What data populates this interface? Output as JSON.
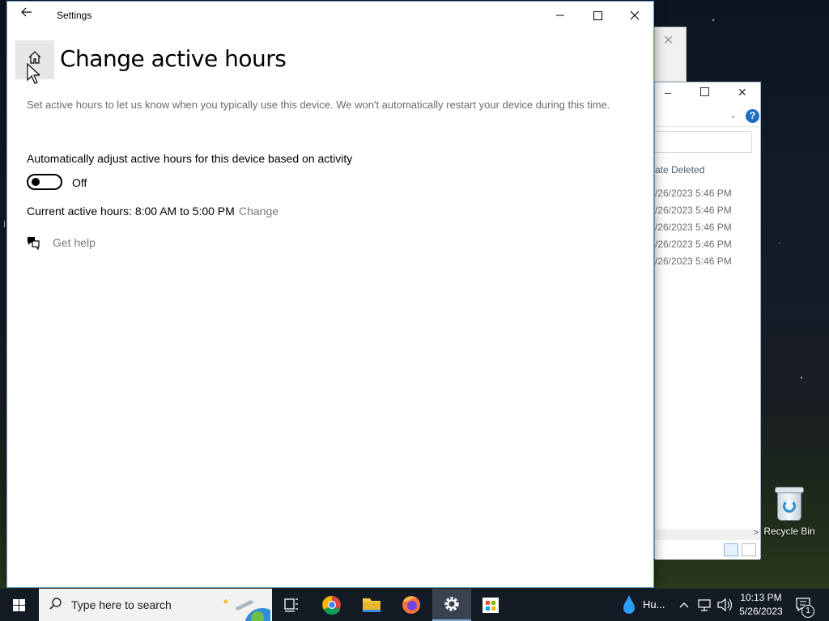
{
  "settings_window": {
    "title": "Settings",
    "page_title": "Change active hours",
    "description": "Set active hours to let us know when you typically use this device. We won't automatically restart your device during this time.",
    "auto_adjust_label": "Automatically adjust active hours for this device based on activity",
    "toggle_state": "Off",
    "current_hours_text": "Current active hours: 8:00 AM to 5:00 PM",
    "change_link": "Change",
    "get_help_link": "Get help"
  },
  "explorer": {
    "column_header": "ate Deleted",
    "rows": [
      "/26/2023 5:46 PM",
      "/26/2023 5:46 PM",
      "/26/2023 5:46 PM",
      "/26/2023 5:46 PM",
      "/26/2023 5:46 PM"
    ]
  },
  "desktop": {
    "recycle_bin_label": "Recycle Bin"
  },
  "taskbar": {
    "search_placeholder": "Type here to search",
    "weather_text": "Hu...",
    "time": "10:13 PM",
    "date": "5/26/2023",
    "notification_count": "1"
  },
  "colors": {
    "accent": "#0078d4",
    "taskbar": "#141b25",
    "link_gray": "#7a7a7a"
  }
}
